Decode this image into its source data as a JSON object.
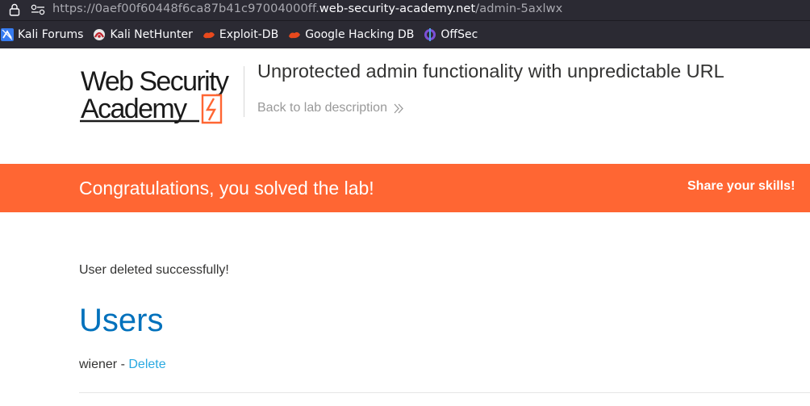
{
  "browser": {
    "url_prefix": "https://0aef00f60448f6ca87b41c97004000ff.",
    "url_host": "web-security-academy.net",
    "url_path": "/admin-5axlwx"
  },
  "bookmarks": [
    {
      "label": "Kali Forums",
      "icon": "kali-forums-icon"
    },
    {
      "label": "Kali NetHunter",
      "icon": "kali-nethunter-icon"
    },
    {
      "label": "Exploit-DB",
      "icon": "exploit-db-icon"
    },
    {
      "label": "Google Hacking DB",
      "icon": "google-hacking-db-icon"
    },
    {
      "label": "OffSec",
      "icon": "offsec-icon"
    }
  ],
  "header": {
    "logo_line1": "Web Security",
    "logo_line2": "Academy",
    "lab_title": "Unprotected admin functionality with unpredictable URL",
    "back_link": "Back to lab description"
  },
  "banner": {
    "message": "Congratulations, you solved the lab!",
    "share": "Share your skills!"
  },
  "content": {
    "status_message": "User deleted successfully!",
    "users_heading": "Users",
    "users": [
      {
        "name": "wiener",
        "separator": " - ",
        "action": "Delete"
      }
    ]
  },
  "colors": {
    "accent": "#ff6633",
    "heading_blue": "#0071bc",
    "link_blue": "#29a9e1"
  }
}
